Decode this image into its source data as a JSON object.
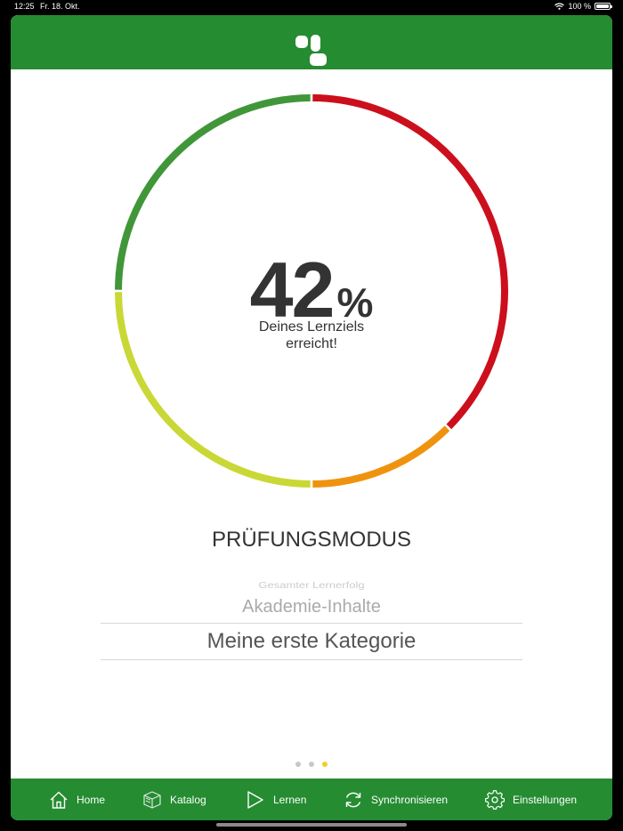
{
  "status_bar": {
    "time": "12:25",
    "date": "Fr. 18. Okt.",
    "battery": "100 %"
  },
  "progress": {
    "value": "42",
    "unit": "%",
    "caption_line1": "Deines Lernziels",
    "caption_line2": "erreicht!"
  },
  "ring_segments": [
    {
      "from": 0,
      "to": 37.5,
      "color": "#cc0f1c"
    },
    {
      "from": 37.5,
      "to": 50,
      "color": "#ef930e"
    },
    {
      "from": 50,
      "to": 75,
      "color": "#c9d836"
    },
    {
      "from": 75,
      "to": 100,
      "color": "#41963a"
    }
  ],
  "mode_title": "PRÜFUNGSMODUS",
  "picker": {
    "far_option": "Gesamter Lernerfolg",
    "near_option": "Akademie-Inhalte",
    "selected_option": "Meine erste Kategorie"
  },
  "page_dots": {
    "count": 3,
    "active": 2
  },
  "tabbar": {
    "home": "Home",
    "katalog": "Katalog",
    "lernen": "Lernen",
    "sync": "Synchronisieren",
    "settings": "Einstellungen"
  },
  "colors": {
    "brand_green": "#258c31",
    "text_dark": "#333333",
    "dot_active": "#e9d326"
  }
}
